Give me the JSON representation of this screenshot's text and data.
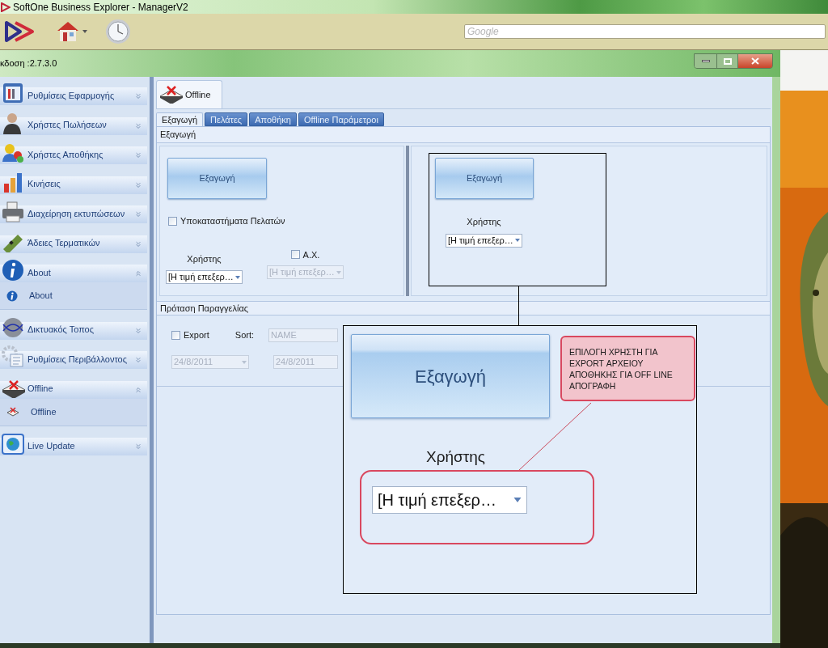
{
  "app_title": "SoftOne Business Explorer - ManagerV2",
  "search": {
    "placeholder": "Google"
  },
  "version": "κδοση :2.7.3.0",
  "sidebar": {
    "groups": [
      {
        "label": "Ρυθμίσεις Εφαρμογής",
        "expanded": false
      },
      {
        "label": "Χρήστες Πωλήσεων",
        "expanded": false
      },
      {
        "label": "Χρήστες Αποθήκης",
        "expanded": false
      },
      {
        "label": "Κινήσεις",
        "expanded": false
      },
      {
        "label": "Διαχείρηση εκτυπώσεων",
        "expanded": false
      },
      {
        "label": "Άδειες Τερματικών",
        "expanded": false
      },
      {
        "label": "About",
        "expanded": true,
        "children": [
          {
            "label": "About"
          }
        ]
      },
      {
        "label": "Δικτυακός Τοπος",
        "expanded": false
      },
      {
        "label": "Ρυθμίσεις Περιβάλλοντος",
        "expanded": false
      },
      {
        "label": "Offline",
        "expanded": true,
        "children": [
          {
            "label": "Offline"
          }
        ]
      },
      {
        "label": "Live Update",
        "expanded": false
      }
    ]
  },
  "document_tab": {
    "label": "Offline"
  },
  "tabs": [
    {
      "label": "Εξαγωγή",
      "selected": true
    },
    {
      "label": "Πελάτες",
      "selected": false
    },
    {
      "label": "Αποθήκη",
      "selected": false
    },
    {
      "label": "Offline Παράμετροι",
      "selected": false
    }
  ],
  "export_section": {
    "title": "Εξαγωγή",
    "left": {
      "button": "Εξαγωγή",
      "branches": {
        "label": "Υποκαταστήματα Πελατών",
        "checked": false
      },
      "user_label": "Χρήστης",
      "user_combo": {
        "value": "[Η τιμή επεξερ…",
        "disabled": false
      },
      "ax": {
        "label": "A.X.",
        "checked": false
      },
      "ax_combo": {
        "value": "[Η τιμή επεξερ…",
        "disabled": true
      }
    },
    "right": {
      "button": "Εξαγωγή",
      "user_label": "Χρήστης",
      "user_combo": {
        "value": "[Η τιμή επεξερ…",
        "disabled": false
      }
    }
  },
  "order_section": {
    "title": "Πρόταση Παραγγελίας",
    "export": {
      "label": "Export",
      "checked": false
    },
    "sort_label": "Sort:",
    "sort_field": {
      "value": "NAME",
      "disabled": true
    },
    "date_from": {
      "value": "24/8/2011",
      "disabled": true
    },
    "date_to": {
      "value": "24/8/2011",
      "disabled": true
    }
  },
  "callout": {
    "button": "Εξαγωγή",
    "user_label": "Χρήστης",
    "user_combo": "[Η τιμή επεξερ…",
    "note": "ΕΠΙΛΟΓΗ ΧΡΗΣΤΗ ΓΙΑ EXPORT ΑΡΧΕΙΟΥ ΑΠΟΘΗΚΗΣ ΓΙΑ OFF LINE ΑΠΟΓΡΑΦΗ"
  }
}
